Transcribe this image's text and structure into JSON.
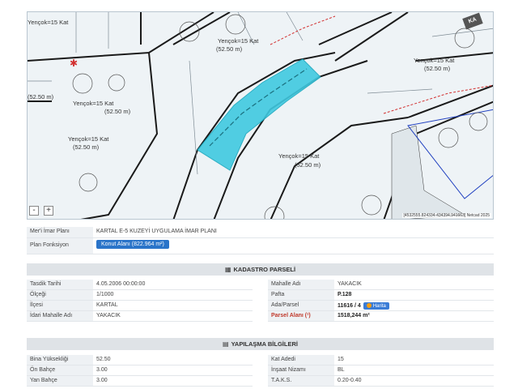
{
  "map": {
    "labels": [
      {
        "text": "Yençok=15 Kat"
      },
      {
        "text": "(52.50 m)"
      },
      {
        "text": "Yençok=15 Kat"
      },
      {
        "text": "(52.50 m)"
      },
      {
        "text": "Yençok=15 Kat"
      },
      {
        "text": "(52.50 m)"
      },
      {
        "text": "Yençok=15 Kat"
      },
      {
        "text": "(52.50 m)"
      },
      {
        "text": "Yençok=15 Kat"
      },
      {
        "text": "(52.50 m)"
      },
      {
        "text": "Yençok=15 Kat"
      },
      {
        "text": "(52.50 m)"
      }
    ],
    "coords": "[4532555.824334-434394.941663] Netcad 2025",
    "logo": "KA",
    "zoom_out": "-",
    "zoom_in": "+"
  },
  "plan": {
    "meri_label": "Mer'i İmar Planı",
    "meri_value": "KARTAL E-5 KUZEYİ UYGULAMA İMAR PLANI",
    "fonksiyon_label": "Plan Fonksiyon",
    "fonksiyon_button": "Konut Alanı (822.964 m²)"
  },
  "kadastro": {
    "title": "KADASTRO PARSELİ",
    "left": [
      {
        "label": "Tasdik Tarihi",
        "value": "4.05.2006 00:00:00"
      },
      {
        "label": "Ölçeği",
        "value": "1/1000"
      },
      {
        "label": "İlçesi",
        "value": "KARTAL"
      },
      {
        "label": "İdari Mahalle Adı",
        "value": "YAKACIK"
      }
    ],
    "right": [
      {
        "label": "Mahalle Adı",
        "value": "YAKACIK"
      },
      {
        "label": "Pafta",
        "value": "P.128"
      },
      {
        "label": "Ada/Parsel",
        "value": "11616 / 4"
      },
      {
        "label": "Parsel Alanı (¹)",
        "value": "1518,244 m²"
      }
    ],
    "harita": "Harita"
  },
  "yapilasma": {
    "title": "YAPILAŞMA BİLGİLERİ",
    "left": [
      {
        "label": "Bina Yüksekliği",
        "value": "52.50"
      },
      {
        "label": "Ön Bahçe",
        "value": "3.00"
      },
      {
        "label": "Yan Bahçe",
        "value": "3.00"
      }
    ],
    "right": [
      {
        "label": "Kat Adedi",
        "value": "15"
      },
      {
        "label": "İnşaat Nizamı",
        "value": "BL"
      },
      {
        "label": "T.A.K.S.",
        "value": "0.20-0.40"
      }
    ]
  },
  "colors": {
    "parcel": "#3fc9e0",
    "button": "#2a74c9",
    "header": "#dfe3e7"
  }
}
